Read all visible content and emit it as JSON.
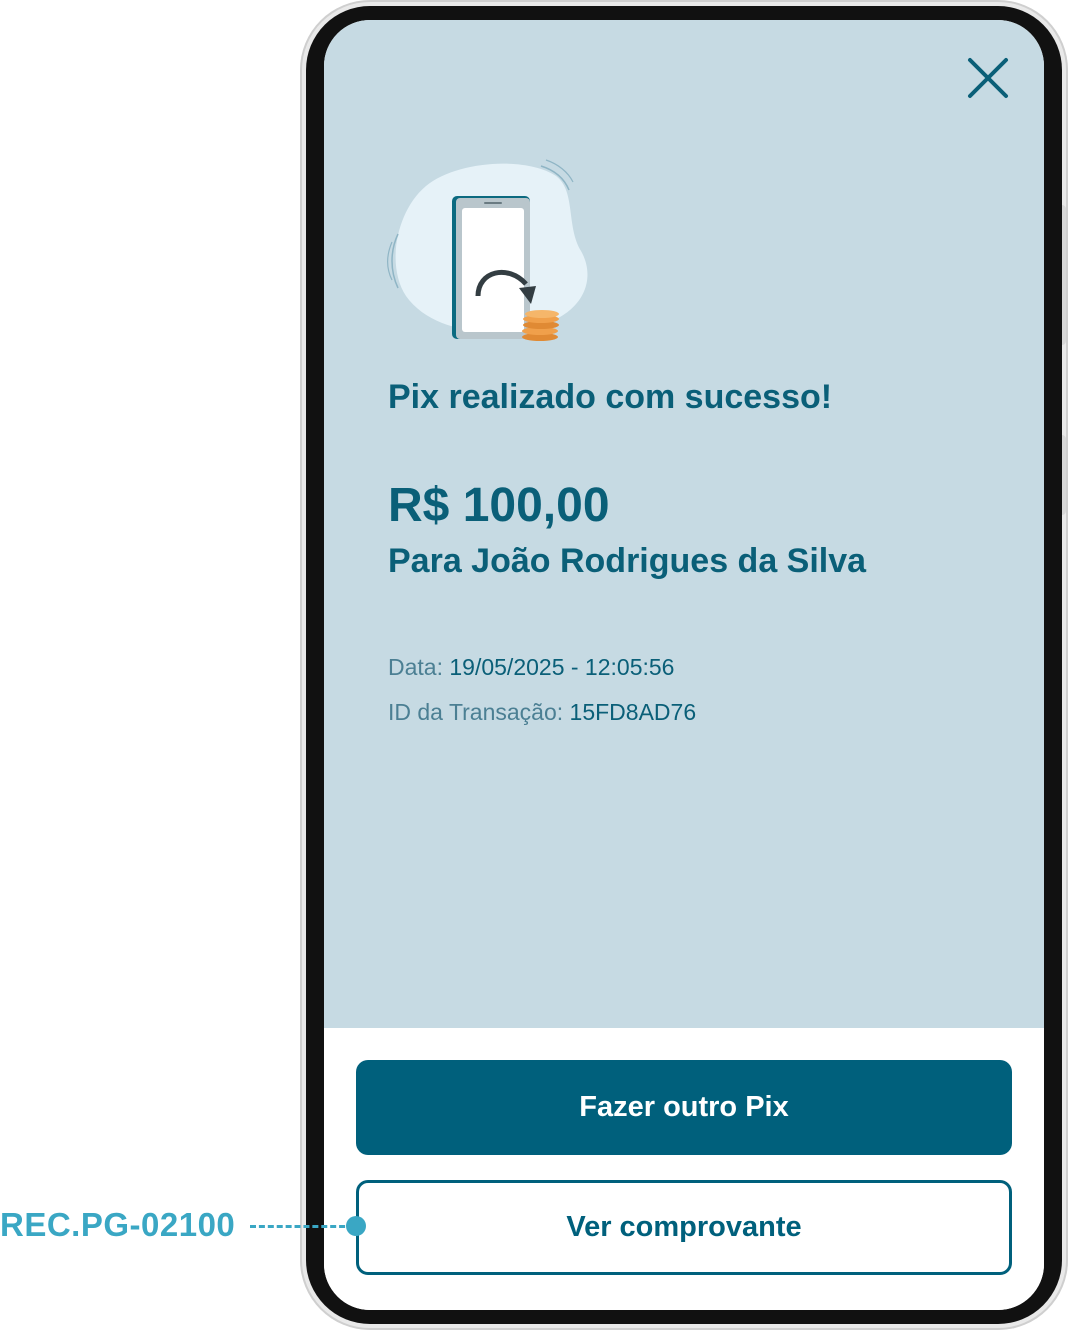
{
  "screen": {
    "title": "Pix realizado com sucesso!",
    "amount": "R$ 100,00",
    "recipient": "Para João Rodrigues da Silva",
    "details": {
      "date_label": "Data:",
      "date_value": "19/05/2025 - 12:05:56",
      "id_label": "ID da Transação:",
      "id_value": "15FD8AD76"
    },
    "icons": {
      "close": "close-icon",
      "illustration": "phone-transfer-coins-illustration"
    }
  },
  "footer": {
    "primary_button": "Fazer outro Pix",
    "secondary_button": "Ver comprovante"
  },
  "annotation": {
    "code": "REC.PG-02100"
  },
  "colors": {
    "background": "#c6dae3",
    "primary": "#00607c",
    "text": "#0a5f78",
    "label": "#4b7f93",
    "annotation": "#3aa7c4",
    "coins": "#f0a04b"
  }
}
